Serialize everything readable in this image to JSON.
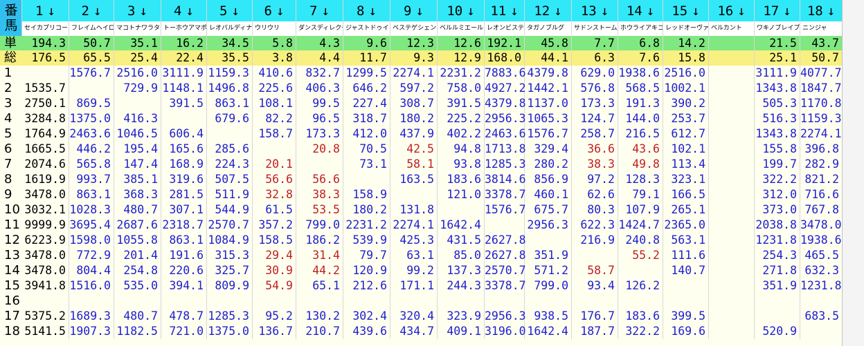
{
  "corner_chars": [
    "番",
    "馬"
  ],
  "columns": [
    {
      "num": "1",
      "arrow": "↓",
      "name": "セイカプリコーン"
    },
    {
      "num": "2",
      "arrow": "↓",
      "name": "フレイムヘイロー"
    },
    {
      "num": "3",
      "arrow": "↓",
      "name": "マコトナワラタナ"
    },
    {
      "num": "4",
      "arrow": "↓",
      "name": "トーホウアマポー"
    },
    {
      "num": "5",
      "arrow": "↓",
      "name": "レオバルディナ"
    },
    {
      "num": "6",
      "arrow": "↓",
      "name": "ウリウリ"
    },
    {
      "num": "7",
      "arrow": "↓",
      "name": "ダンスディレクタ"
    },
    {
      "num": "8",
      "arrow": "↓",
      "name": "ジャストドゥイン"
    },
    {
      "num": "9",
      "arrow": "↓",
      "name": "ベステゲシェンク"
    },
    {
      "num": "10",
      "arrow": "↓",
      "name": "ベルルミエール"
    },
    {
      "num": "11",
      "arrow": "↓",
      "name": "レオンビスティー"
    },
    {
      "num": "12",
      "arrow": "↓",
      "name": "タガノブルグ"
    },
    {
      "num": "13",
      "arrow": "↓",
      "name": "サドンストーム"
    },
    {
      "num": "14",
      "arrow": "↓",
      "name": "ホウライアキコ"
    },
    {
      "num": "15",
      "arrow": "↓",
      "name": "レッドオーヴァル"
    },
    {
      "num": "16",
      "arrow": "↓",
      "name": "ベルカント"
    },
    {
      "num": "17",
      "arrow": "↓",
      "name": "ワキノブレイブ"
    },
    {
      "num": "18",
      "arrow": "↓",
      "name": "ニンジャ"
    }
  ],
  "win_row": {
    "label": "単",
    "bg": "#80e880",
    "values": [
      "194.3",
      "50.7",
      "35.1",
      "16.2",
      "34.5",
      "5.8",
      "4.3",
      "9.6",
      "12.3",
      "12.6",
      "192.1",
      "45.8",
      "7.7",
      "6.8",
      "14.2",
      "",
      "21.5",
      "43.7"
    ]
  },
  "total_row": {
    "label": "総",
    "bg": "#f8f080",
    "values": [
      "176.5",
      "65.5",
      "25.4",
      "22.4",
      "35.5",
      "3.8",
      "4.4",
      "11.7",
      "9.3",
      "12.9",
      "168.0",
      "44.1",
      "6.3",
      "7.6",
      "15.8",
      "",
      "25.1",
      "50.7"
    ]
  },
  "colors": {
    "blue": "#2020d0",
    "red": "#c02020",
    "black": "#000000",
    "header_cyan": "#30e8f8",
    "corner_blue": "#30c0f0"
  },
  "rows": [
    {
      "label": "1",
      "cells": [
        "",
        "1576.7",
        "2516.0",
        "3111.9",
        "1159.3",
        "410.6",
        "832.7",
        "1299.5",
        "2274.1",
        "2231.2",
        "7883.6",
        "4379.8",
        "629.0",
        "1938.6",
        "2516.0",
        "",
        "3111.9",
        "4077.7"
      ]
    },
    {
      "label": "2",
      "cells": [
        "1535.7",
        "",
        "729.9",
        "1148.1",
        "1496.8",
        "225.6",
        "406.3",
        "646.2",
        "597.2",
        "758.0",
        "4927.2",
        "1442.1",
        "576.8",
        "568.5",
        "1002.1",
        "",
        "1343.8",
        "1847.7"
      ]
    },
    {
      "label": "3",
      "cells": [
        "2750.1",
        "869.5",
        "",
        "391.5",
        "863.1",
        "108.1",
        "99.5",
        "227.4",
        "308.7",
        "391.5",
        "4379.8",
        "1137.0",
        "173.3",
        "191.3",
        "390.2",
        "",
        "505.3",
        "1170.8"
      ]
    },
    {
      "label": "4",
      "cells": [
        "3284.8",
        "1375.0",
        "416.3",
        "",
        "679.6",
        "82.2",
        "96.5",
        "318.7",
        "180.2",
        "225.2",
        "2956.3",
        "1065.3",
        "124.7",
        "144.0",
        "253.7",
        "",
        "516.3",
        "1159.3"
      ]
    },
    {
      "label": "5",
      "cells": [
        "1764.9",
        "2463.6",
        "1046.5",
        "606.4",
        "",
        "158.7",
        "173.3",
        "412.0",
        "437.9",
        "402.2",
        "2463.6",
        "1576.7",
        "258.7",
        "216.5",
        "612.7",
        "",
        "1343.8",
        "2274.1"
      ]
    },
    {
      "label": "6",
      "cells": [
        "1665.5",
        "446.2",
        "195.4",
        "165.6",
        "285.6",
        "",
        "20.8",
        "70.5",
        "42.5",
        "94.8",
        "1713.8",
        "329.4",
        "36.6",
        "43.6",
        "102.1",
        "",
        "155.8",
        "396.8"
      ]
    },
    {
      "label": "7",
      "cells": [
        "2074.6",
        "565.8",
        "147.4",
        "168.9",
        "224.3",
        "20.1",
        "",
        "73.1",
        "58.1",
        "93.8",
        "1285.3",
        "280.2",
        "38.3",
        "49.8",
        "113.4",
        "",
        "199.7",
        "282.9"
      ]
    },
    {
      "label": "8",
      "cells": [
        "1619.9",
        "993.7",
        "385.1",
        "319.6",
        "507.5",
        "56.6",
        "56.6",
        "",
        "163.5",
        "183.6",
        "3814.6",
        "856.9",
        "97.2",
        "128.3",
        "323.1",
        "",
        "322.2",
        "821.2"
      ]
    },
    {
      "label": "9",
      "cells": [
        "3478.0",
        "863.1",
        "368.3",
        "281.5",
        "511.9",
        "32.8",
        "38.3",
        "158.9",
        "",
        "121.0",
        "3378.7",
        "460.1",
        "62.6",
        "79.1",
        "166.5",
        "",
        "312.0",
        "716.6"
      ]
    },
    {
      "label": "10",
      "cells": [
        "3032.1",
        "1028.3",
        "480.7",
        "307.1",
        "544.9",
        "61.5",
        "53.5",
        "180.2",
        "131.8",
        "",
        "1576.7",
        "675.7",
        "80.3",
        "107.9",
        "265.1",
        "",
        "373.0",
        "767.8"
      ]
    },
    {
      "label": "11",
      "cells": [
        "9999.9",
        "3695.4",
        "2687.6",
        "2318.7",
        "2570.7",
        "357.2",
        "799.0",
        "2231.2",
        "2274.1",
        "1642.4",
        "",
        "2956.3",
        "622.3",
        "1424.7",
        "2365.0",
        "",
        "2038.8",
        "3478.0"
      ]
    },
    {
      "label": "12",
      "cells": [
        "6223.9",
        "1598.0",
        "1055.8",
        "863.1",
        "1084.9",
        "158.5",
        "186.2",
        "539.9",
        "425.3",
        "431.5",
        "2627.8",
        "",
        "216.9",
        "240.8",
        "563.1",
        "",
        "1231.8",
        "1938.6"
      ]
    },
    {
      "label": "13",
      "cells": [
        "3478.0",
        "772.9",
        "201.4",
        "191.6",
        "315.3",
        "29.4",
        "31.4",
        "79.7",
        "63.1",
        "85.0",
        "2627.8",
        "351.9",
        "",
        "55.2",
        "111.6",
        "",
        "254.3",
        "465.5"
      ]
    },
    {
      "label": "14",
      "cells": [
        "3478.0",
        "804.4",
        "254.8",
        "220.6",
        "325.7",
        "30.9",
        "44.2",
        "120.9",
        "99.2",
        "137.3",
        "2570.7",
        "571.2",
        "58.7",
        "",
        "140.7",
        "",
        "271.8",
        "632.3"
      ]
    },
    {
      "label": "15",
      "cells": [
        "3941.8",
        "1516.0",
        "535.0",
        "394.1",
        "809.9",
        "54.9",
        "65.1",
        "212.6",
        "171.1",
        "244.3",
        "3378.7",
        "799.0",
        "93.4",
        "126.2",
        "",
        "",
        "351.9",
        "1231.8"
      ]
    },
    {
      "label": "16",
      "cells": [
        "",
        "",
        "",
        "",
        "",
        "",
        "",
        "",
        "",
        "",
        "",
        "",
        "",
        "",
        "",
        "",
        "",
        ""
      ]
    },
    {
      "label": "17",
      "cells": [
        "5375.2",
        "1689.3",
        "480.7",
        "478.7",
        "1285.3",
        "95.2",
        "130.2",
        "302.4",
        "320.4",
        "323.9",
        "2956.3",
        "938.5",
        "176.7",
        "183.6",
        "399.5",
        "",
        "",
        "683.5"
      ]
    },
    {
      "label": "18",
      "cells": [
        "5141.5",
        "1907.3",
        "1182.5",
        "721.0",
        "1375.0",
        "136.7",
        "210.7",
        "439.6",
        "434.7",
        "409.1",
        "3196.0",
        "1642.4",
        "187.7",
        "322.2",
        "169.6",
        "",
        "520.9",
        ""
      ]
    }
  ]
}
